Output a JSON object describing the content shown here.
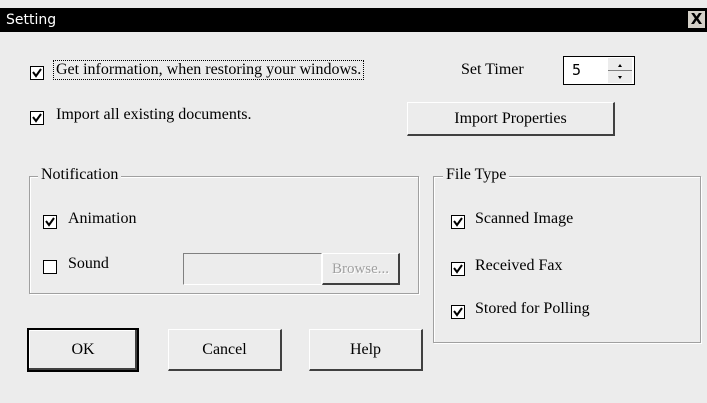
{
  "window": {
    "title": "Setting",
    "close_label": "X"
  },
  "options": {
    "get_info_label": "Get information, when restoring your windows.",
    "get_info_checked": true,
    "import_docs_label": "Import all existing documents.",
    "import_docs_checked": true
  },
  "timer": {
    "label": "Set Timer",
    "value": "5"
  },
  "import_properties_label": "Import Properties",
  "notification": {
    "legend": "Notification",
    "animation_label": "Animation",
    "animation_checked": true,
    "sound_label": "Sound",
    "sound_checked": false,
    "sound_file": "",
    "browse_label": "Browse..."
  },
  "file_type": {
    "legend": "File Type",
    "scanned_label": "Scanned Image",
    "scanned_checked": true,
    "fax_label": "Received Fax",
    "fax_checked": true,
    "polling_label": "Stored for Polling",
    "polling_checked": true
  },
  "buttons": {
    "ok": "OK",
    "cancel": "Cancel",
    "help": "Help"
  }
}
